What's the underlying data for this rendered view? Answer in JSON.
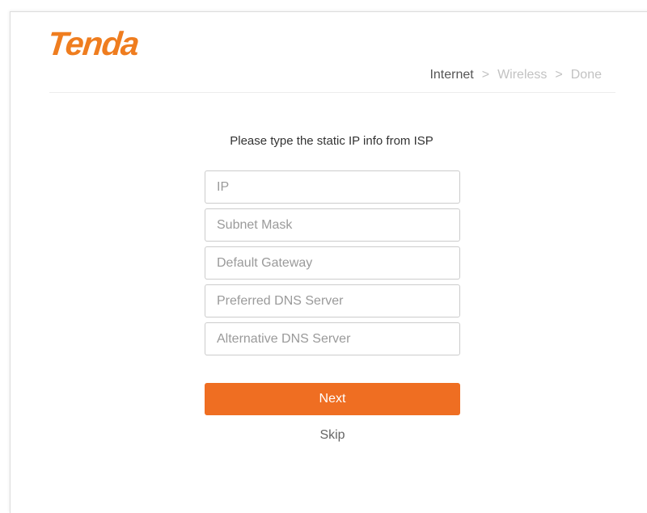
{
  "brand": {
    "logo_text": "Tenda",
    "accent_color": "#ef7d1f"
  },
  "steps": [
    {
      "label": "Internet",
      "state": "active"
    },
    {
      "label": "Wireless",
      "state": "inactive"
    },
    {
      "label": "Done",
      "state": "inactive"
    }
  ],
  "step_separator": ">",
  "form": {
    "prompt": "Please type the static IP info from ISP",
    "fields": [
      {
        "placeholder": "IP",
        "value": ""
      },
      {
        "placeholder": "Subnet Mask",
        "value": ""
      },
      {
        "placeholder": "Default Gateway",
        "value": ""
      },
      {
        "placeholder": "Preferred DNS Server",
        "value": ""
      },
      {
        "placeholder": "Alternative DNS Server",
        "value": ""
      }
    ],
    "next_label": "Next",
    "next_color": "#ef6e22",
    "skip_label": "Skip"
  }
}
